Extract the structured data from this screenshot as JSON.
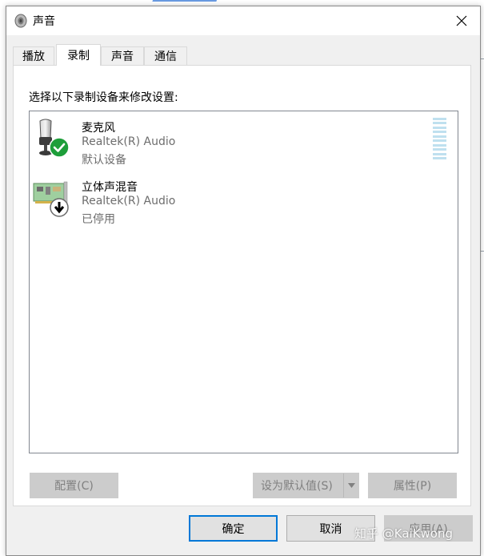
{
  "window": {
    "title": "声音",
    "close_glyph": "✕"
  },
  "tabs": [
    {
      "label": "播放",
      "active": false
    },
    {
      "label": "录制",
      "active": true
    },
    {
      "label": "声音",
      "active": false
    },
    {
      "label": "通信",
      "active": false
    }
  ],
  "panel": {
    "instruction": "选择以下录制设备来修改设置:"
  },
  "devices": [
    {
      "name": "麦克风",
      "driver": "Realtek(R) Audio",
      "status": "默认设备",
      "icon": "microphone-icon",
      "badge": "default-check-icon"
    },
    {
      "name": "立体声混音",
      "driver": "Realtek(R) Audio",
      "status": "已停用",
      "icon": "sound-card-icon",
      "badge": "disabled-arrow-icon"
    }
  ],
  "panel_buttons": {
    "configure": "配置(C)",
    "set_default": "设为默认值(S)",
    "properties": "属性(P)"
  },
  "footer_buttons": {
    "ok": "确定",
    "cancel": "取消",
    "apply": "应用(A)"
  },
  "watermark": "知乎 @KaiKwong",
  "colors": {
    "accent": "#0078d7",
    "check_green": "#1e9e3a",
    "meter": "#bfe0ef",
    "disabled_text": "#808080"
  }
}
